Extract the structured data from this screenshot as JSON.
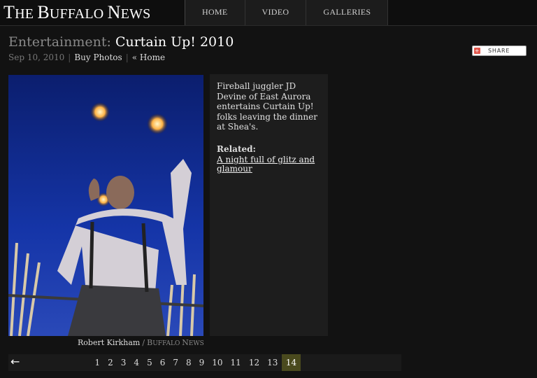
{
  "header": {
    "logo_lead": "T",
    "logo_word1": "HE ",
    "logo_b": "B",
    "logo_word2": "UFFALO ",
    "logo_n": "N",
    "logo_word3": "EWS",
    "nav": [
      "HOME",
      "VIDEO",
      "GALLERIES"
    ]
  },
  "page": {
    "section": "Entertainment:",
    "title": "Curtain Up! 2010",
    "date": "Sep 10, 2010",
    "buy_photos": "Buy Photos",
    "home_link": "« Home",
    "share_label": "SHARE"
  },
  "photo": {
    "caption": "Fireball juggler JD Devine of East Aurora entertains Curtain Up! folks leaving the dinner at Shea's.",
    "related_heading": "Related:",
    "related_link": "A night full of glitz and glamour",
    "credit_name": "Robert Kirkham",
    "credit_org_b": "B",
    "credit_org_rest1": "UFFALO ",
    "credit_org_n": "N",
    "credit_org_rest2": "EWS"
  },
  "pagination": {
    "pages": [
      "1",
      "2",
      "3",
      "4",
      "5",
      "6",
      "7",
      "8",
      "9",
      "10",
      "11",
      "12",
      "13",
      "14"
    ],
    "current": "14"
  },
  "colors": {
    "background": "#121212",
    "active_page": "#4a4a1e",
    "sky": "#12309a"
  }
}
